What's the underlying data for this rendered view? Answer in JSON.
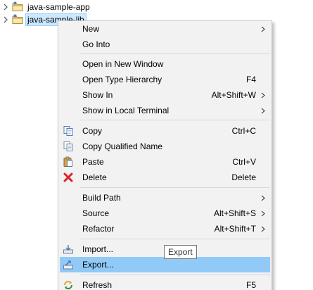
{
  "tree": {
    "items": [
      {
        "label": "java-sample-app",
        "selected": false
      },
      {
        "label": "java-sample-lib",
        "selected": true
      }
    ]
  },
  "menu": {
    "items": {
      "new": {
        "label": "New",
        "has_submenu": true
      },
      "go_into": {
        "label": "Go Into"
      },
      "open_new_window": {
        "label": "Open in New Window"
      },
      "open_type_hierarchy": {
        "label": "Open Type Hierarchy",
        "shortcut": "F4"
      },
      "show_in": {
        "label": "Show In",
        "shortcut": "Alt+Shift+W",
        "has_submenu": true
      },
      "show_local_terminal": {
        "label": "Show in Local Terminal",
        "has_submenu": true
      },
      "copy": {
        "label": "Copy",
        "shortcut": "Ctrl+C",
        "icon": "copy-icon"
      },
      "copy_qualified": {
        "label": "Copy Qualified Name",
        "icon": "copy-qualified-icon"
      },
      "paste": {
        "label": "Paste",
        "shortcut": "Ctrl+V",
        "icon": "paste-icon"
      },
      "delete": {
        "label": "Delete",
        "shortcut": "Delete",
        "icon": "delete-icon"
      },
      "build_path": {
        "label": "Build Path",
        "has_submenu": true
      },
      "source": {
        "label": "Source",
        "shortcut": "Alt+Shift+S",
        "has_submenu": true
      },
      "refactor": {
        "label": "Refactor",
        "shortcut": "Alt+Shift+T",
        "has_submenu": true
      },
      "import": {
        "label": "Import...",
        "icon": "import-icon"
      },
      "export": {
        "label": "Export...",
        "icon": "export-icon",
        "highlighted": true
      },
      "refresh": {
        "label": "Refresh",
        "shortcut": "F5",
        "icon": "refresh-icon"
      }
    },
    "highlight_color": "#91c9f7",
    "background_color": "#f2f2f2"
  },
  "tooltip": {
    "text": "Export"
  }
}
